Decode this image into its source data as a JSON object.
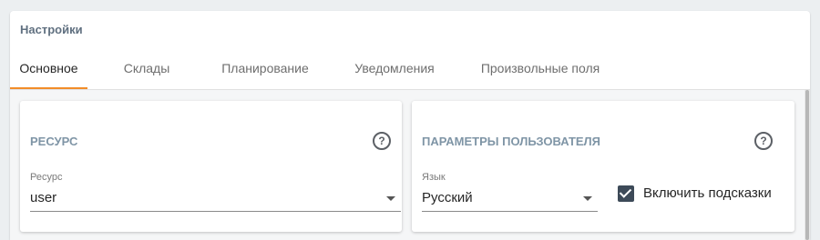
{
  "settings": {
    "title": "Настройки",
    "tabs": [
      {
        "label": "Основное",
        "active": true
      },
      {
        "label": "Склады",
        "active": false
      },
      {
        "label": "Планирование",
        "active": false
      },
      {
        "label": "Уведомления",
        "active": false
      },
      {
        "label": "Произвольные поля",
        "active": false
      }
    ],
    "accent_color": "#f28c28"
  },
  "resource_card": {
    "title": "РЕСУРС",
    "help_icon": "question-circle-icon",
    "field_label": "Ресурс",
    "field_value": "user"
  },
  "user_params_card": {
    "title": "ПАРАМЕТРЫ ПОЛЬЗОВАТЕЛЯ",
    "help_icon": "question-circle-icon",
    "language_label": "Язык",
    "language_value": "Русский",
    "hints_checkbox_label": "Включить подсказки",
    "hints_checked": true
  }
}
